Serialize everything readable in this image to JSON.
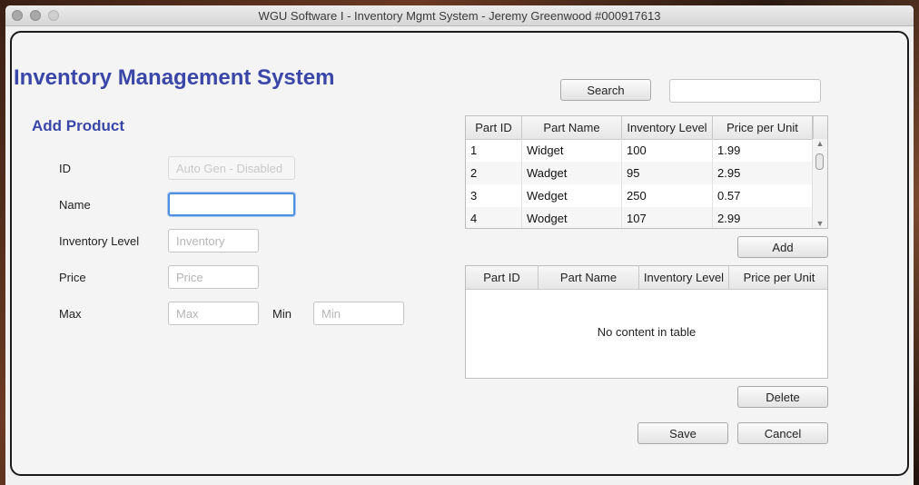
{
  "window": {
    "title": "WGU Software I - Inventory Mgmt System - Jeremy Greenwood #000917613"
  },
  "app": {
    "title": "Inventory Management System"
  },
  "form": {
    "section_title": "Add Product",
    "id_label": "ID",
    "id_placeholder": "Auto Gen - Disabled",
    "name_label": "Name",
    "name_value": "",
    "inventory_label": "Inventory Level",
    "inventory_placeholder": "Inventory",
    "price_label": "Price",
    "price_placeholder": "Price",
    "max_label": "Max",
    "max_placeholder": "Max",
    "min_label": "Min",
    "min_placeholder": "Min"
  },
  "search": {
    "button_label": "Search",
    "value": ""
  },
  "parts_table": {
    "columns": [
      "Part ID",
      "Part Name",
      "Inventory Level",
      "Price per Unit"
    ],
    "rows": [
      [
        "1",
        "Widget",
        "100",
        "1.99"
      ],
      [
        "2",
        "Wadget",
        "95",
        "2.95"
      ],
      [
        "3",
        "Wedget",
        "250",
        "0.57"
      ],
      [
        "4",
        "Wodget",
        "107",
        "2.99"
      ]
    ]
  },
  "add_button_label": "Add",
  "associated_table": {
    "columns": [
      "Part ID",
      "Part Name",
      "Inventory Level",
      "Price per Unit"
    ],
    "empty_text": "No content in table"
  },
  "delete_button_label": "Delete",
  "save_button_label": "Save",
  "cancel_button_label": "Cancel",
  "icons": {
    "close": "window-close-icon",
    "minimize": "window-minimize-icon",
    "zoom": "window-zoom-icon",
    "scroll_up": "chevron-up-icon",
    "scroll_down": "chevron-down-icon"
  },
  "colors": {
    "title_blue": "#3a47a8",
    "focus_ring": "#4f8fe0"
  }
}
